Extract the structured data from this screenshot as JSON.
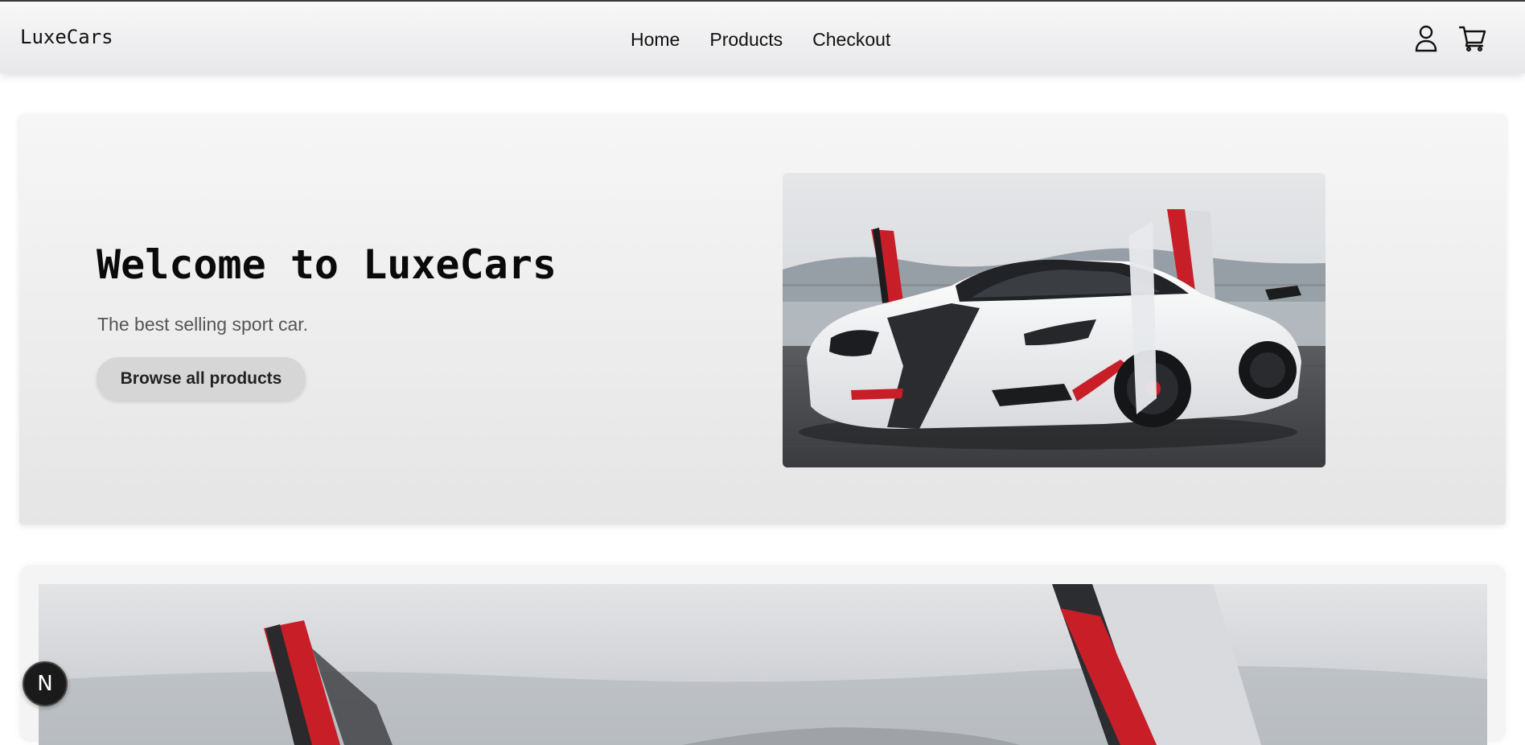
{
  "navbar": {
    "brand": "LuxeCars",
    "links": [
      {
        "label": "Home"
      },
      {
        "label": "Products"
      },
      {
        "label": "Checkout"
      }
    ],
    "icons": [
      "user-icon",
      "cart-icon"
    ]
  },
  "hero": {
    "title": "Welcome to LuxeCars",
    "subtitle": "The best selling sport car.",
    "cta_label": "Browse all products",
    "image": "white-red-supercar-photo"
  },
  "banner": {
    "image": "white-red-supercar-closeup-photo"
  },
  "dev_badge": {
    "letter": "N"
  },
  "colors": {
    "nav_bg": "#efeff0",
    "hero_bg": "#ececec",
    "button_bg": "#d6d6d7",
    "car_red": "#c81e28",
    "car_white": "#f3f4f5",
    "badge_bg": "#1a1a1a"
  }
}
